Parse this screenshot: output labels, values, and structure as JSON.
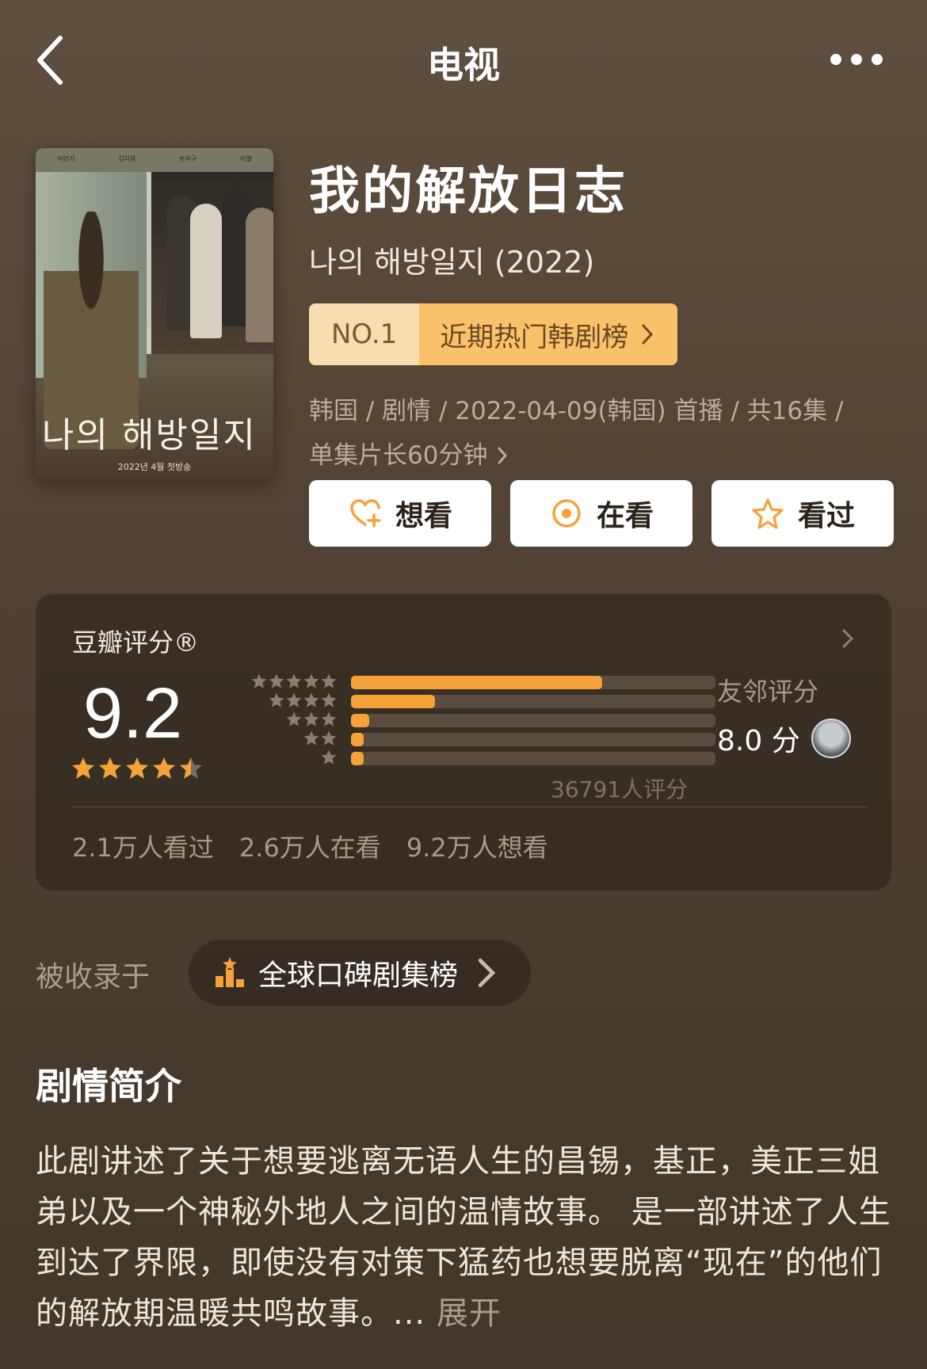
{
  "nav": {
    "title": "电视"
  },
  "poster": {
    "title_kr": "나의 해방일지",
    "date_text": "2022년 4월 첫방송",
    "cast": [
      "이민기",
      "김지원",
      "손석구",
      "이엘"
    ]
  },
  "show": {
    "title": "我的解放日志",
    "original_title": "나의 해방일지 (2022)",
    "rank_no": "NO.1",
    "rank_label": "近期热门韩剧榜",
    "meta_line1": "韩国 / 剧情 / 2022-04-09(韩国) 首播 / 共16集 /",
    "meta_line2": "单集片长60分钟"
  },
  "actions": {
    "want": "想看",
    "watching": "在看",
    "watched": "看过"
  },
  "rating": {
    "label": "豆瓣评分®",
    "score": "9.2",
    "star_level": 4.5,
    "distribution": [
      0.69,
      0.23,
      0.05,
      0.03,
      0.03
    ],
    "count_text": "36791人评分",
    "friend_label": "友邻评分",
    "friend_score": "8.0 分",
    "stats": [
      "2.1万人看过",
      "2.6万人在看",
      "9.2万人想看"
    ]
  },
  "collected": {
    "label": "被收录于",
    "chip": "全球口碑剧集榜"
  },
  "summary": {
    "title": "剧情简介",
    "text": "此剧讲述了关于想要逃离无语人生的昌锡，基正，美正三姐弟以及一个神秘外地人之间的温情故事。 是一部讲述了人生到达了界限，即使没有对策下猛药也想要脱离“现在”的他们的解放期温暖共鸣故事。...",
    "expand": "展开"
  },
  "colors": {
    "accent": "#f5a23b",
    "rank_no_bg": "#f7ddb0",
    "rank_label_bg": "#f9c26a"
  }
}
